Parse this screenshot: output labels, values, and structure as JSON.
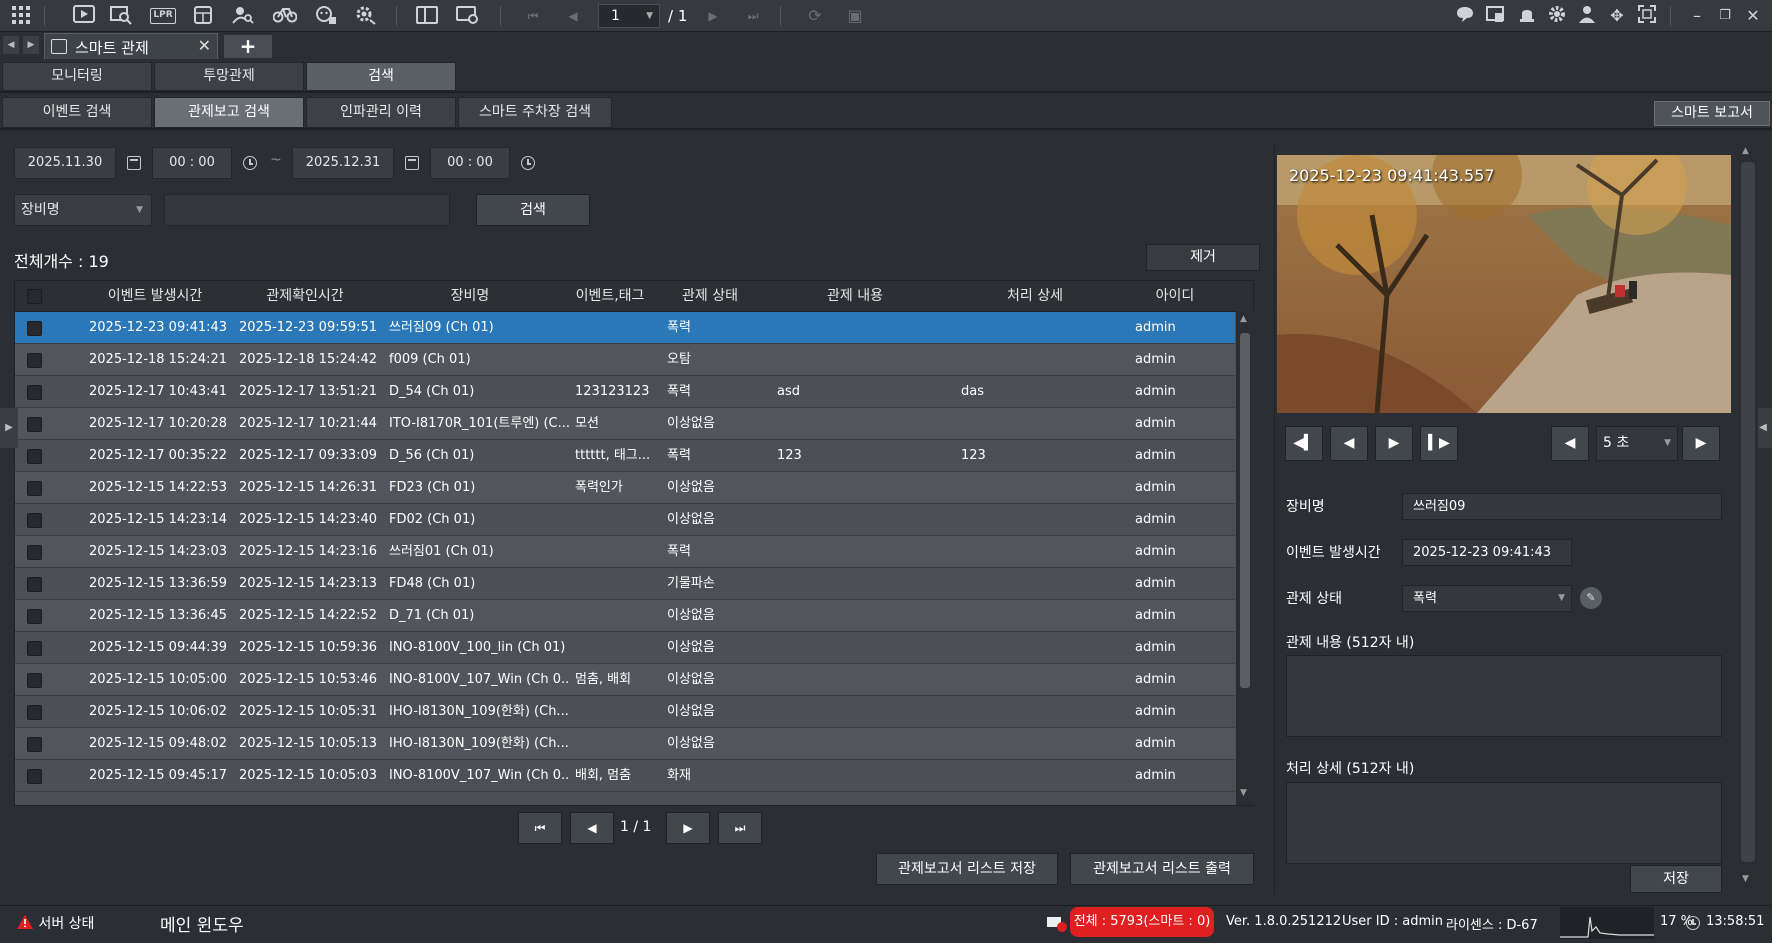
{
  "toolbar": {
    "page_current": "1",
    "page_total": "/ 1",
    "left_icons": [
      "grid-menu-icon",
      "video-play-icon",
      "search-video-icon",
      "lpr-icon",
      "camera-grid-icon",
      "person-search-icon",
      "bicycle-icon",
      "face-icon",
      "settings-search-icon",
      "layout-icon",
      "monitor-settings-icon"
    ],
    "lpr_label": "LPR"
  },
  "tabs": {
    "main_tab_label": "스마트 관제",
    "add_tab": "+",
    "level1": [
      "모니터링",
      "투망관제",
      "검색"
    ],
    "level1_active": 2,
    "level2": [
      "이벤트 검색",
      "관제보고 검색",
      "인파관리 이력",
      "스마트 주차장 검색"
    ],
    "level2_active": 1,
    "smart_report": "스마트 보고서"
  },
  "filters": {
    "start_date": "2025.11.30",
    "start_time": "00 : 00",
    "dash": "~",
    "end_date": "2025.12.31",
    "end_time": "00 : 00",
    "device_select": "장비명",
    "search_button": "검색"
  },
  "summary": {
    "total": "전체개수 : 19",
    "remove_button": "제거"
  },
  "table": {
    "columns": [
      "이벤트 발생시간",
      "관제확인시간",
      "장비명",
      "이벤트,태그",
      "관제 상태",
      "관제 내용",
      "처리 상세",
      "아이디"
    ],
    "rows": [
      [
        "2025-12-23 09:41:43",
        "2025-12-23 09:59:51",
        "쓰러짐09 (Ch 01)",
        "",
        "폭력",
        "",
        "",
        "admin"
      ],
      [
        "2025-12-18 15:24:21",
        "2025-12-18 15:24:42",
        "f009 (Ch 01)",
        "",
        "오탐",
        "",
        "",
        "admin"
      ],
      [
        "2025-12-17 10:43:41",
        "2025-12-17 13:51:21",
        "D_54 (Ch 01)",
        "123123123",
        "폭력",
        "asd",
        "das",
        "admin"
      ],
      [
        "2025-12-17 10:20:28",
        "2025-12-17 10:21:44",
        "ITO-I8170R_101(트루엔) (C...",
        "모션",
        "이상없음",
        "",
        "",
        "admin"
      ],
      [
        "2025-12-17 00:35:22",
        "2025-12-17 09:33:09",
        "D_56 (Ch 01)",
        "tttttt, 태그...",
        "폭력",
        "123",
        "123",
        "admin"
      ],
      [
        "2025-12-15 14:22:53",
        "2025-12-15 14:26:31",
        "FD23 (Ch 01)",
        "폭력인가",
        "이상없음",
        "",
        "",
        "admin"
      ],
      [
        "2025-12-15 14:23:14",
        "2025-12-15 14:23:40",
        "FD02 (Ch 01)",
        "",
        "이상없음",
        "",
        "",
        "admin"
      ],
      [
        "2025-12-15 14:23:03",
        "2025-12-15 14:23:16",
        "쓰러짐01 (Ch 01)",
        "",
        "폭력",
        "",
        "",
        "admin"
      ],
      [
        "2025-12-15 13:36:59",
        "2025-12-15 14:23:13",
        "FD48 (Ch 01)",
        "",
        "기물파손",
        "",
        "",
        "admin"
      ],
      [
        "2025-12-15 13:36:45",
        "2025-12-15 14:22:52",
        "D_71 (Ch 01)",
        "",
        "이상없음",
        "",
        "",
        "admin"
      ],
      [
        "2025-12-15 09:44:39",
        "2025-12-15 10:59:36",
        "INO-8100V_100_lin (Ch 01)",
        "",
        "이상없음",
        "",
        "",
        "admin"
      ],
      [
        "2025-12-15 10:05:00",
        "2025-12-15 10:53:46",
        "INO-8100V_107_Win (Ch 0...",
        "멈춤, 배회",
        "이상없음",
        "",
        "",
        "admin"
      ],
      [
        "2025-12-15 10:06:02",
        "2025-12-15 10:05:31",
        "IHO-I8130N_109(한화) (Ch...",
        "",
        "이상없음",
        "",
        "",
        "admin"
      ],
      [
        "2025-12-15 09:48:02",
        "2025-12-15 10:05:13",
        "IHO-I8130N_109(한화) (Ch...",
        "",
        "이상없음",
        "",
        "",
        "admin"
      ],
      [
        "2025-12-15 09:45:17",
        "2025-12-15 10:05:03",
        "INO-8100V_107_Win (Ch 0...",
        "배회, 멈춤",
        "화재",
        "",
        "",
        "admin"
      ]
    ]
  },
  "pagination": {
    "first": "⏮",
    "prev": "◀",
    "text": "1  /  1",
    "next": "▶",
    "last": "⏭"
  },
  "list_buttons": {
    "save": "관제보고서 리스트 저장",
    "print": "관제보고서 리스트 출력"
  },
  "detail": {
    "timestamp": "2025-12-23 09:41:43.557",
    "seconds": "5 초",
    "device_label": "장비명",
    "device_value": "쓰러짐09",
    "event_time_label": "이벤트 발생시간",
    "event_time_value": "2025-12-23 09:41:43",
    "status_label": "관제 상태",
    "status_value": "폭력",
    "content_label": "관제 내용 (512자 내)",
    "detail_label": "처리 상세 (512자 내)",
    "save": "저장"
  },
  "statusbar": {
    "server_status": "서버 상태",
    "main_window": "메인 윈도우",
    "total_badge": "전체 : 5793(스마트 : 0)",
    "version": "Ver. 1.8.0.251212",
    "user": "User ID : admin",
    "license": "라이센스 : D-67",
    "cpu": "17 %",
    "clock": "13:58:51"
  },
  "colors": {
    "selected_row": "#2a78b8",
    "alert": "#e02020",
    "background": "#2b2f35"
  }
}
